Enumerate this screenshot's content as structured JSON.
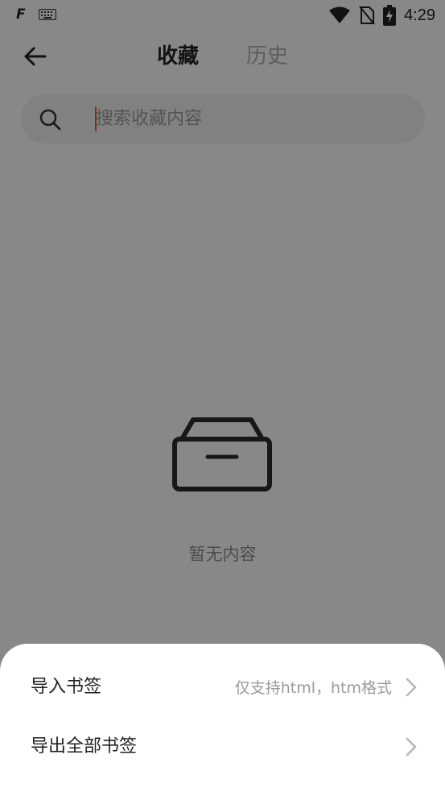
{
  "status_bar": {
    "app_letter": "F",
    "time": "4:29",
    "icons": [
      "keyboard-icon",
      "wifi-icon",
      "no-sim-icon",
      "battery-charging-icon"
    ]
  },
  "header": {
    "back_icon": "arrow-left-icon",
    "tabs": [
      {
        "label": "收藏",
        "active": true
      },
      {
        "label": "历史",
        "active": false
      }
    ]
  },
  "search": {
    "placeholder": "搜索收藏内容",
    "icon": "search-icon"
  },
  "empty_state": {
    "icon": "empty-box-icon",
    "text": "暂无内容"
  },
  "bottom_sheet": {
    "items": [
      {
        "label": "导入书签",
        "hint": "仅支持html，htm格式",
        "icon": "chevron-right-icon"
      },
      {
        "label": "导出全部书签",
        "hint": "",
        "icon": "chevron-right-icon"
      }
    ]
  },
  "colors": {
    "accent_caret": "#e35a2a",
    "scrim": "rgba(0,0,0,0.45)",
    "sheet_bg": "#ffffff"
  }
}
